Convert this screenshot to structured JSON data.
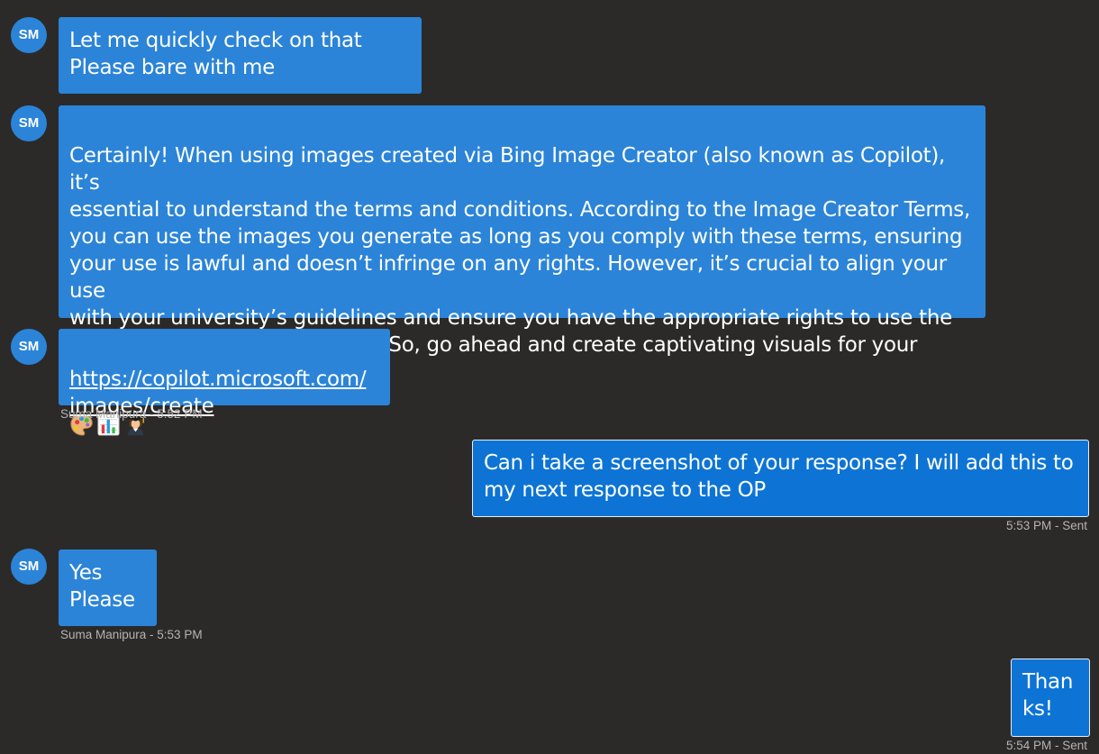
{
  "conversation": {
    "agent_initials": "SM",
    "messages": [
      {
        "from": "agent",
        "text": "Let me quickly check on that\nPlease bare with me"
      },
      {
        "from": "agent",
        "text": "Certainly! When using images created via Bing Image Creator (also known as Copilot), it’s\nessential to understand the terms and conditions. According to the Image Creator Terms,\nyou can use the images you generate as long as you comply with these terms, ensuring\nyour use is lawful and doesn’t infringe on any rights. However, it’s crucial to align your use\nwith your university’s guidelines and ensure you have the appropriate rights to use the\nimages for your presentation1. So, go ahead and create captivating visuals for your\nuniversity presentations!",
        "emojis": [
          "palette-emoji",
          "bar-chart-emoji",
          "graduate-emoji"
        ]
      },
      {
        "from": "agent",
        "link_text": "https://copilot.microsoft.com/\nimages/create",
        "meta": "Suma Manipura - 5:52 PM"
      },
      {
        "from": "user",
        "text": "Can i take a screenshot of your response? I will add this to\nmy next response to the OP",
        "meta": "5:53 PM - Sent"
      },
      {
        "from": "agent",
        "text": "Yes\nPlease",
        "meta": "Suma Manipura - 5:53 PM"
      },
      {
        "from": "user",
        "text": "Than\nks!",
        "meta": "5:54 PM - Sent"
      }
    ]
  },
  "colors": {
    "background": "#2b2a29",
    "agent_bubble": "#2b84d8",
    "user_bubble": "#0d74d5",
    "meta_text": "#b6b4b2"
  }
}
